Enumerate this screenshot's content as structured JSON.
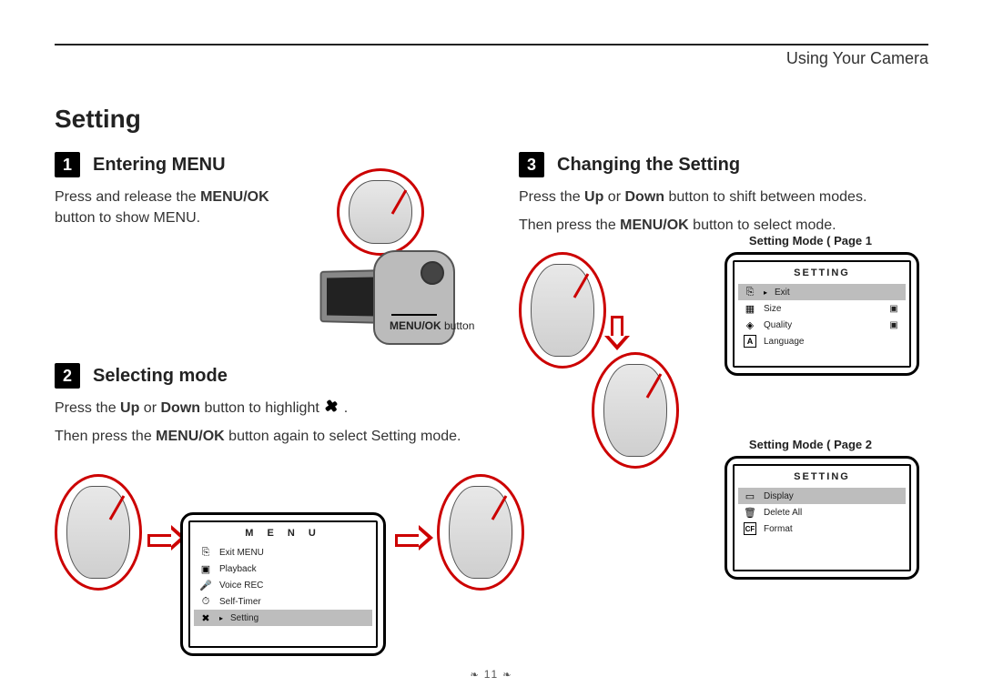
{
  "chapter": "Using Your Camera",
  "title": "Setting",
  "steps": {
    "s1": {
      "num": "1",
      "title": "Entering MENU",
      "para": [
        "Press and release the ",
        "MENU/OK",
        " button to show MENU."
      ]
    },
    "s2": {
      "num": "2",
      "title": "Selecting mode",
      "para1_pre": "Press the ",
      "para1_b1": "Up",
      "para1_mid": " or ",
      "para1_b2": "Down",
      "para1_post": " button to highlight ",
      "para2": [
        "Then press the ",
        "MENU/OK",
        " button again to select Setting mode."
      ]
    },
    "s3": {
      "num": "3",
      "title": "Changing the Setting",
      "para1": [
        "Press the ",
        "Up",
        " or ",
        "Down",
        " button to shift between modes."
      ],
      "para2": [
        "Then press the ",
        "MENU/OK",
        " button to select mode."
      ]
    }
  },
  "menuok_label": {
    "b": "MENU/OK ",
    "t": "button"
  },
  "main_menu": {
    "title": "M E N U",
    "rows": [
      {
        "icon": "⎘",
        "label": "Exit MENU",
        "selected": false
      },
      {
        "icon": "▣",
        "label": "Playback",
        "selected": false
      },
      {
        "icon": "🎤",
        "label": "Voice REC",
        "selected": false
      },
      {
        "icon": "⏱",
        "label": "Self-Timer",
        "selected": false
      },
      {
        "icon": "✖",
        "label": "Setting",
        "selected": true,
        "pointer": "▸"
      }
    ]
  },
  "setting_page1": {
    "label": "Setting Mode ( Page 1",
    "title": "SETTING",
    "rows": [
      {
        "icon": "⎘",
        "label": "Exit",
        "selected": true,
        "pointer": "▸"
      },
      {
        "icon": "▦",
        "label": "Size",
        "tail": "▣"
      },
      {
        "icon": "◈",
        "label": "Quality",
        "tail": "▣"
      },
      {
        "icon": "A",
        "label": "Language"
      }
    ]
  },
  "setting_page2": {
    "label": "Setting Mode ( Page 2",
    "title": "SETTING",
    "rows": [
      {
        "icon": "▭",
        "label": "Display",
        "selected": true
      },
      {
        "icon": "🗑",
        "label": "Delete All"
      },
      {
        "icon": "CF",
        "label": "Format"
      }
    ]
  },
  "page_number": "11"
}
